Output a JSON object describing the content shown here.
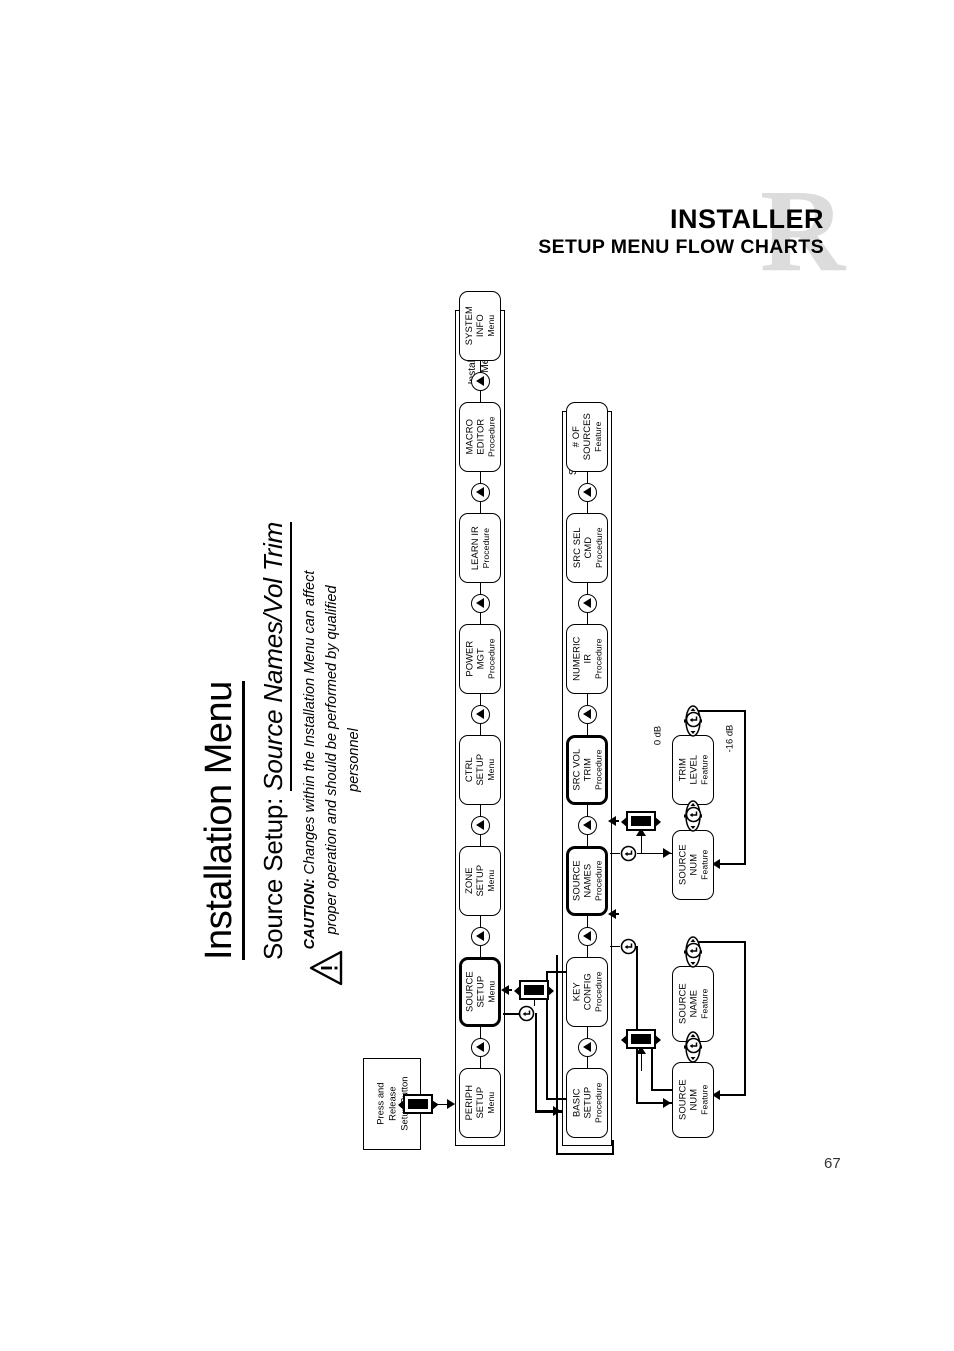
{
  "header": {
    "title": "INSTALLER",
    "subtitle": "SETUP MENU FLOW CHARTS",
    "watermark": "R"
  },
  "document": {
    "title": "Installation Menu",
    "subtitle_prefix": "Source Setup: ",
    "subtitle_italic": "Source Names/Vol Trim",
    "caution_label": "CAUTION:",
    "caution_text": " Changes within the Installation Menu can affect proper operation and should be performed by qualified personnel",
    "warning_icon": "warning-triangle-icon",
    "page_number": "67"
  },
  "flow": {
    "start": {
      "label": "Press and\nRelease\nSetup Button",
      "display_icon": "lcd-display-icon"
    },
    "installation_menu": {
      "group_label": "Installation\nMenu",
      "nodes": [
        {
          "id": "periph-setup",
          "name": "PERIPH\nSETUP",
          "kind": "Menu"
        },
        {
          "id": "source-setup",
          "name": "SOURCE\nSETUP",
          "kind": "Menu",
          "highlight": true
        },
        {
          "id": "zone-setup",
          "name": "ZONE\nSETUP",
          "kind": "Menu"
        },
        {
          "id": "ctrl-setup",
          "name": "CTRL\nSETUP",
          "kind": "Menu"
        },
        {
          "id": "power-mgt",
          "name": "POWER\nMGT",
          "kind": "Procedure"
        },
        {
          "id": "learn-ir",
          "name": "LEARN IR",
          "kind": "Procedure"
        },
        {
          "id": "macro-editor",
          "name": "MACRO\nEDITOR",
          "kind": "Procedure"
        },
        {
          "id": "system-info",
          "name": "SYSTEM\nINFO",
          "kind": "Menu"
        }
      ]
    },
    "source_setup_menu": {
      "group_label": "Source\nSetup\nMenu",
      "nodes": [
        {
          "id": "basic-setup",
          "name": "BASIC\nSETUP",
          "kind": "Procedure"
        },
        {
          "id": "key-config",
          "name": "KEY\nCONFIG",
          "kind": "Procedure"
        },
        {
          "id": "source-names",
          "name": "SOURCE\nNAMES",
          "kind": "Procedure",
          "highlight": true
        },
        {
          "id": "src-vol-trim",
          "name": "SRC VOL\nTRIM",
          "kind": "Procedure",
          "highlight": true
        },
        {
          "id": "numeric-ir",
          "name": "NUMERIC\nIR",
          "kind": "Procedure"
        },
        {
          "id": "src-sel-cmd",
          "name": "SRC SEL\nCMD",
          "kind": "Procedure"
        },
        {
          "id": "num-sources",
          "name": "# OF\nSOURCES",
          "kind": "Feature"
        }
      ]
    },
    "vol_trim_branch": {
      "nodes": [
        {
          "id": "trim-source-num",
          "name": "SOURCE\nNUM",
          "kind": "Feature"
        },
        {
          "id": "trim-level",
          "name": "TRIM\nLEVEL",
          "kind": "Feature"
        }
      ],
      "range_min": "-16 dB",
      "range_max": "0 dB"
    },
    "source_names_branch": {
      "nodes": [
        {
          "id": "names-source-num",
          "name": "SOURCE\nNUM",
          "kind": "Feature"
        },
        {
          "id": "names-source-name",
          "name": "SOURCE\nNAME",
          "kind": "Feature"
        }
      ]
    },
    "icons": {
      "nav_button": "up-arrow-button-icon",
      "knob": "rotary-knob-icon",
      "enter": "press-enter-icon",
      "display": "lcd-display-icon"
    }
  }
}
